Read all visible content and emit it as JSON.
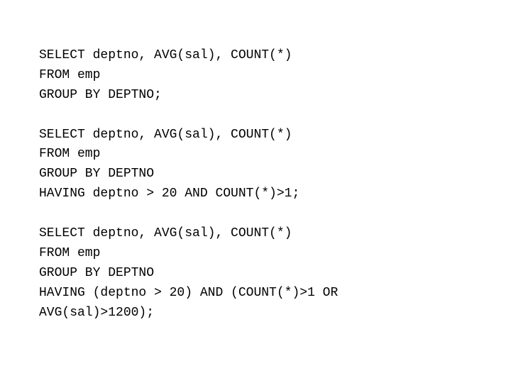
{
  "sql": {
    "query1": {
      "line1": "SELECT deptno, AVG(sal), COUNT(*)",
      "line2": "FROM emp",
      "line3": "GROUP BY DEPTNO;"
    },
    "query2": {
      "line1": "SELECT deptno, AVG(sal), COUNT(*)",
      "line2": "FROM emp",
      "line3": "GROUP BY DEPTNO",
      "line4": "HAVING deptno > 20 AND COUNT(*)>1;"
    },
    "query3": {
      "line1": "SELECT deptno, AVG(sal), COUNT(*)",
      "line2": "FROM emp",
      "line3": "GROUP BY DEPTNO",
      "line4": "HAVING (deptno > 20) AND (COUNT(*)>1 OR",
      "line5": "AVG(sal)>1200);"
    }
  }
}
